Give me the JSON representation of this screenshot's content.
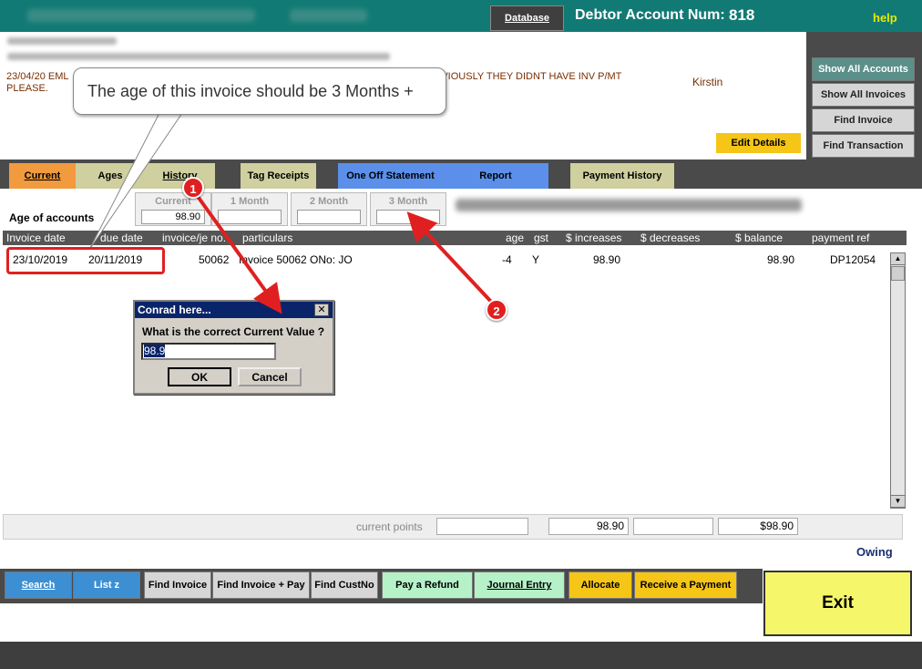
{
  "header": {
    "database_label": "Database",
    "account_label": "Debtor Account Num:",
    "account_number": "818",
    "help_label": "help"
  },
  "right_menu": {
    "show_all_accounts": "Show All Accounts",
    "show_all_invoices": "Show All Invoices",
    "find_invoice": "Find Invoice",
    "find_transaction": "Find Transaction"
  },
  "customer": {
    "note_line1": "23/04/20 EML",
    "note_line1_end": "BVIOUSLY THEY DIDNT HAVE INV P/MT",
    "note_line2": "PLEASE.",
    "staff_name": "Kirstin",
    "edit_details": "Edit Details"
  },
  "tabs": {
    "current": "Current",
    "ages": "Ages",
    "history": "History",
    "tag_receipts": "Tag Receipts",
    "one_off_statement": "One Off Statement",
    "report": "Report",
    "payment_history": "Payment History"
  },
  "aging": {
    "title": "Age of accounts",
    "buckets": [
      {
        "label": "Current",
        "value": "98.90"
      },
      {
        "label": "1 Month",
        "value": ""
      },
      {
        "label": "2 Month",
        "value": ""
      },
      {
        "label": "3 Month",
        "value": ""
      }
    ]
  },
  "table": {
    "columns": [
      "Invoice date",
      "due date",
      "invoice/je no.",
      "particulars",
      "age",
      "gst",
      "$ increases",
      "$ decreases",
      "$ balance",
      "payment ref"
    ],
    "rows": [
      {
        "invoice_date": "23/10/2019",
        "due_date": "20/11/2019",
        "invoice_no": "50062",
        "particulars": "Invoice 50062 ONo: JO",
        "age": "-4",
        "gst": "Y",
        "increases": "98.90",
        "decreases": "",
        "balance": "98.90",
        "payment_ref": "DP12054"
      }
    ]
  },
  "totals": {
    "label": "current points",
    "points": "",
    "increases": "98.90",
    "decreases": "",
    "balance": "$98.90",
    "owing_label": "Owing"
  },
  "bottom_buttons": {
    "search": "Search",
    "list": "List z",
    "find_invoice": "Find Invoice",
    "find_invoice_pay": "Find Invoice + Pay",
    "find_custno": "Find CustNo",
    "pay_refund": "Pay a Refund",
    "journal_entry": "Journal Entry",
    "allocate": "Allocate",
    "receive_payment": "Receive a Payment",
    "exit": "Exit"
  },
  "dialog": {
    "title": "Conrad here...",
    "close": "✕",
    "question": "What is the correct Current Value ?",
    "input_value": "98.9",
    "ok": "OK",
    "cancel": "Cancel"
  },
  "annotations": {
    "callout_text": "The age of this invoice should be 3 Months +",
    "badge1": "1",
    "badge2": "2",
    "colors": {
      "marker": "#e02020"
    }
  }
}
